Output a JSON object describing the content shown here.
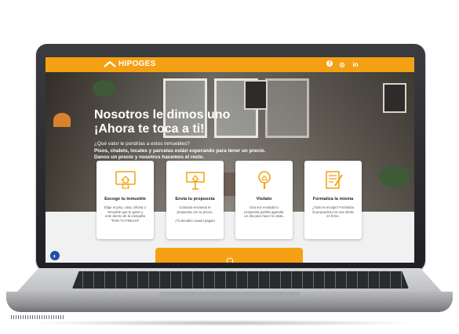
{
  "brand": {
    "name": "HIPOGES",
    "accent": "#f5a014"
  },
  "social": [
    {
      "name": "facebook-icon",
      "glyph": "f"
    },
    {
      "name": "instagram-icon",
      "glyph": "◎"
    },
    {
      "name": "linkedin-icon",
      "glyph": "in"
    }
  ],
  "hero": {
    "title_line1": "Nosotros le dimos uno",
    "title_line2": "¡Ahora te toca a ti!",
    "question": "¿Qué valor le pondrías a estos inmuebles?",
    "line2": "Pisos, chalets, locales y parcelas están esperando para tener un precio.",
    "line3": "Danos un precio y nosotros hacemos el resto."
  },
  "steps": [
    {
      "title": "Escoge tu inmueble",
      "desc": "Elige el piso, casa, oficina o\ninmueble que te guste y\neste dentro de la campaña\n\"PON TU PRECIO\"",
      "icon": "monitor-house-icon"
    },
    {
      "title": "Envía tu propuesta",
      "desc": "Contacta enviando le\npropuesta con tu precio.\n\n¡Tú decides cuanto pagas!",
      "icon": "sign-board-icon"
    },
    {
      "title": "Visítalo",
      "desc": "Una vez enviada tu\npropuesta podrás agendar\nun día para hacer la visita.",
      "icon": "magnifier-house-icon"
    },
    {
      "title": "Formaliza la misma",
      "desc": "¿Todo te encaja? Formaliza\nla propuesta con una oferta\nen firme.",
      "icon": "document-pen-icon"
    }
  ]
}
